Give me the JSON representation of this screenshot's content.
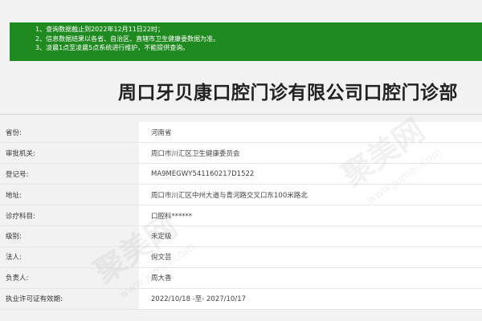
{
  "notice": {
    "lines": [
      "1、查询数据截止到2022年12月11日22时；",
      "2、信息数据结果以各省、自治区、直辖市卫生健康委数据为准。",
      "3、凌晨1点至凌晨5点系统进行维护，不能提供查询。"
    ],
    "bg_color": "#1f8a1f"
  },
  "title": "周口牙贝康口腔门诊有限公司口腔门诊部",
  "rows": [
    {
      "label": "省份:",
      "value": "河南省"
    },
    {
      "label": "审批机关:",
      "value": "周口市川汇区卫生健康委员会"
    },
    {
      "label": "登记号:",
      "value": "MA9MEGWY541160217D1522"
    },
    {
      "label": "地址:",
      "value": "周口市川汇区中州大道与青河路交叉口东100米路北"
    },
    {
      "label": "诊疗科目:",
      "value": "口腔科******"
    },
    {
      "label": "级别:",
      "value": "未定级"
    },
    {
      "label": "法人:",
      "value": "倪文芸"
    },
    {
      "label": "负责人:",
      "value": "周大香"
    },
    {
      "label": "执业许可证有效期:",
      "value": "2022/10/18 -至- 2027/10/17"
    }
  ],
  "watermark": {
    "text": "聚美网",
    "sub": "www.jumei.com"
  }
}
